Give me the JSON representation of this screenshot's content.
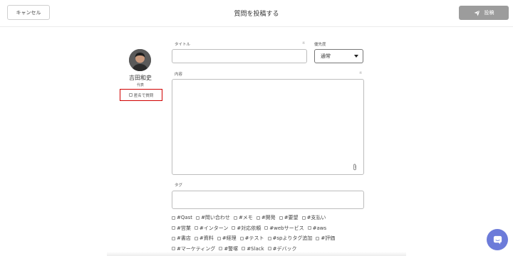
{
  "header": {
    "cancel_label": "キャンセル",
    "title": "質問を投稿する",
    "post_label": "投稿"
  },
  "user": {
    "name": "吉田和史",
    "role": "代表",
    "anonymous_label": "匿名で質問"
  },
  "form": {
    "title_label": "タイトル",
    "priority_label": "優先度",
    "priority_value": "通常",
    "content_label": "内容",
    "tag_label": "タグ",
    "required_mark": "※"
  },
  "tags": [
    [
      "#Qast",
      "#問い合わせ",
      "#メモ",
      "#開発",
      "#要望",
      "#支払い"
    ],
    [
      "#営業",
      "#インターン",
      "#対応依頼",
      "#webサービス",
      "#aws"
    ],
    [
      "#書店",
      "#資料",
      "#経理",
      "#テスト",
      "#spよりタグ追加",
      "#評価"
    ],
    [
      "#マーケティング",
      "#警塚",
      "#Slack",
      "#デバック"
    ]
  ],
  "colors": {
    "post_button": "#9c9c9c",
    "anonymous_highlight": "#d00000",
    "chat_button": "#6c7bd9"
  },
  "icons": {
    "post": "paper-plane-icon",
    "attach": "paperclip-icon",
    "chat": "chat-bubble-icon",
    "dropdown": "caret-down-icon"
  }
}
